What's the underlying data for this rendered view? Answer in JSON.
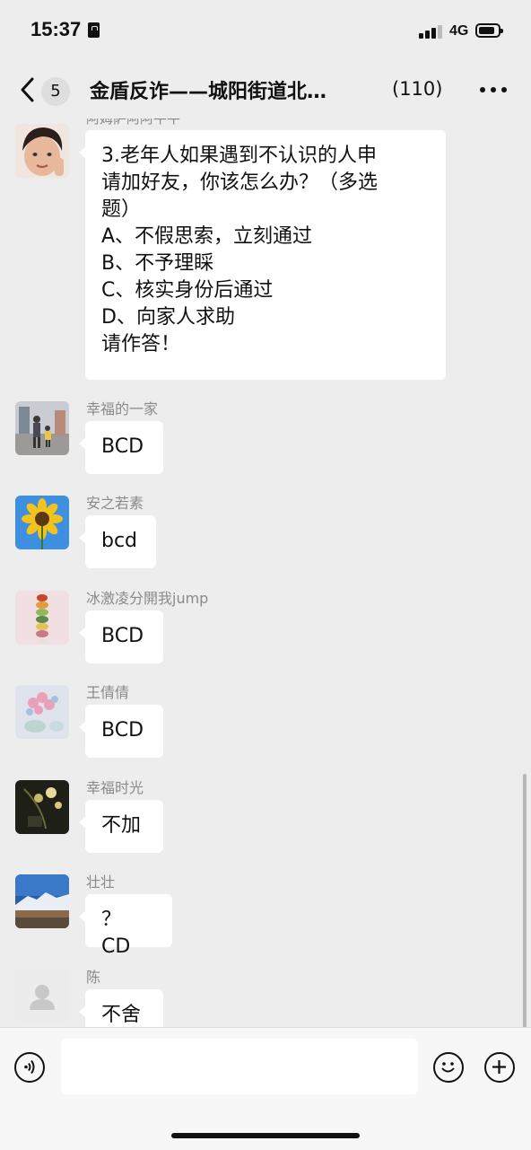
{
  "status_bar": {
    "time": "15:37",
    "network": "4G"
  },
  "nav": {
    "unread_count": "5",
    "title": "金盾反诈——城阳街道北…",
    "member_count": "(110)"
  },
  "chat": {
    "partial_sender": "阿姆萨阿阿牛牛",
    "question_lines": [
      "3.老年人如果遇到不认识的人申",
      "请加好友，你该怎么办？（多选",
      "题）",
      "A、不假思索，立刻通过",
      "B、不予理睬",
      "C、核实身份后通过",
      "D、向家人求助",
      "请作答！"
    ],
    "messages": [
      {
        "sender": "幸福的一家",
        "text": "BCD"
      },
      {
        "sender": "安之若素",
        "text": "bcd"
      },
      {
        "sender": "冰激凌分開我jump",
        "text": "BCD"
      },
      {
        "sender": "王倩倩",
        "text": "BCD"
      },
      {
        "sender": "幸福时光",
        "text": "不加"
      },
      {
        "sender": "壮壮",
        "text": "？ CD"
      },
      {
        "sender": "陈",
        "text": "不舍"
      }
    ]
  },
  "input": {
    "placeholder": ""
  },
  "colors": {
    "background": "#ededed",
    "bubble": "#ffffff",
    "sender_name": "#8a8a8a"
  },
  "icons": [
    "back-chevron-icon",
    "more-dots-icon",
    "voice-icon",
    "emoji-icon",
    "plus-icon",
    "lock-icon",
    "signal-icon",
    "battery-icon"
  ]
}
